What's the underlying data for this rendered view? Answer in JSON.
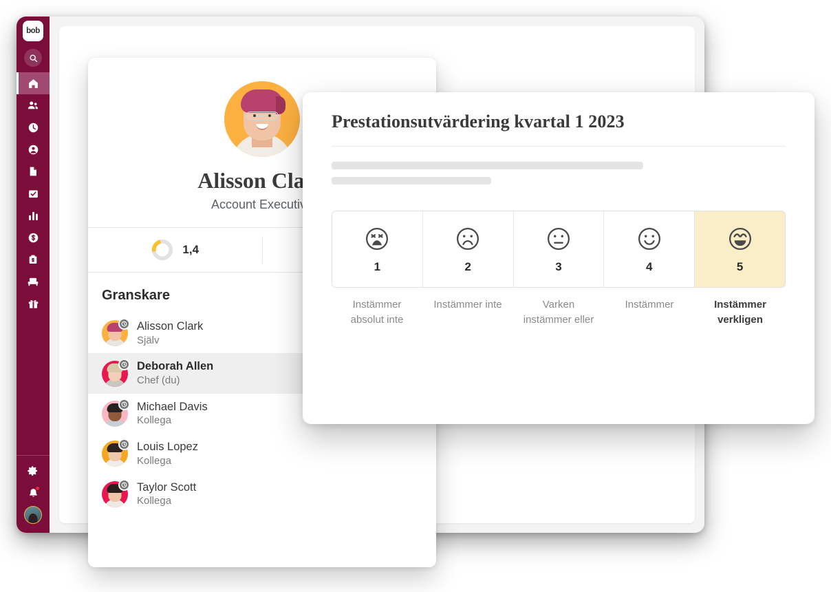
{
  "sidebar": {
    "logo_text": "bob",
    "search_icon": "search-icon",
    "nav_items": [
      {
        "icon": "home-icon",
        "name": "home",
        "active": true
      },
      {
        "icon": "people-icon",
        "name": "people",
        "active": false
      },
      {
        "icon": "clock-icon",
        "name": "time",
        "active": false
      },
      {
        "icon": "person-circle-icon",
        "name": "profile",
        "active": false
      },
      {
        "icon": "document-icon",
        "name": "documents",
        "active": false
      },
      {
        "icon": "clipboard-check-icon",
        "name": "tasks",
        "active": false
      },
      {
        "icon": "bar-chart-icon",
        "name": "analytics",
        "active": false
      },
      {
        "icon": "dollar-circle-icon",
        "name": "compensation",
        "active": false
      },
      {
        "icon": "money-bag-icon",
        "name": "payroll",
        "active": false
      },
      {
        "icon": "workspace-icon",
        "name": "workspace",
        "active": false
      },
      {
        "icon": "gift-icon",
        "name": "benefits",
        "active": false
      }
    ],
    "bottom_items": [
      {
        "icon": "gear-icon",
        "name": "settings"
      },
      {
        "icon": "bell-icon",
        "name": "notifications",
        "has_dot": true
      },
      {
        "icon": "avatar-icon",
        "name": "account"
      }
    ]
  },
  "profile": {
    "name": "Alisson Clark",
    "role": "Account Executive",
    "avatar": "employee-photo",
    "stats": [
      {
        "icon": "donut-chart-icon",
        "value": "1,4"
      },
      {
        "icon": "target-icon",
        "value": ""
      }
    ],
    "reviewers_heading": "Granskare",
    "reviewers": [
      {
        "name": "Alisson Clark",
        "role": "Själv",
        "status_icon": "clock-icon",
        "selected": false,
        "ring": "#fcb040",
        "hair": "#b8426e",
        "skin": "#f0c4a4"
      },
      {
        "name": "Deborah Allen",
        "role": "Chef (du)",
        "status_icon": "clock-icon",
        "selected": true,
        "ring": "#e8174f",
        "hair": "#d9c9a6",
        "skin": "#f2cfb5"
      },
      {
        "name": "Michael Davis",
        "role": "Kollega",
        "status_icon": "clock-icon",
        "selected": false,
        "ring": "#f9b7c4",
        "hair": "#2b2020",
        "skin": "#8d5a3b"
      },
      {
        "name": "Louis Lopez",
        "role": "Kollega",
        "status_icon": "clock-icon",
        "selected": false,
        "ring": "#f5a623",
        "hair": "#2e2320",
        "skin": "#f0c8ab"
      },
      {
        "name": "Taylor Scott",
        "role": "Kollega",
        "status_icon": "clock-icon",
        "selected": false,
        "ring": "#e8174f",
        "hair": "#2a1f1d",
        "skin": "#eec5a7"
      }
    ]
  },
  "evaluation": {
    "title": "Prestationsutvärdering kvartal 1 2023",
    "selected_value": 5,
    "highlight_color": "#faeec8",
    "scale": [
      {
        "value": "1",
        "face": "very-sad-face-icon",
        "label": "Instämmer absolut inte",
        "selected": false
      },
      {
        "value": "2",
        "face": "sad-face-icon",
        "label": "Instämmer inte",
        "selected": false
      },
      {
        "value": "3",
        "face": "neutral-face-icon",
        "label": "Varken instämmer eller",
        "selected": false
      },
      {
        "value": "4",
        "face": "happy-face-icon",
        "label": "Instämmer",
        "selected": false
      },
      {
        "value": "5",
        "face": "very-happy-face-icon",
        "label": "Instämmer verkligen",
        "selected": true
      }
    ]
  }
}
